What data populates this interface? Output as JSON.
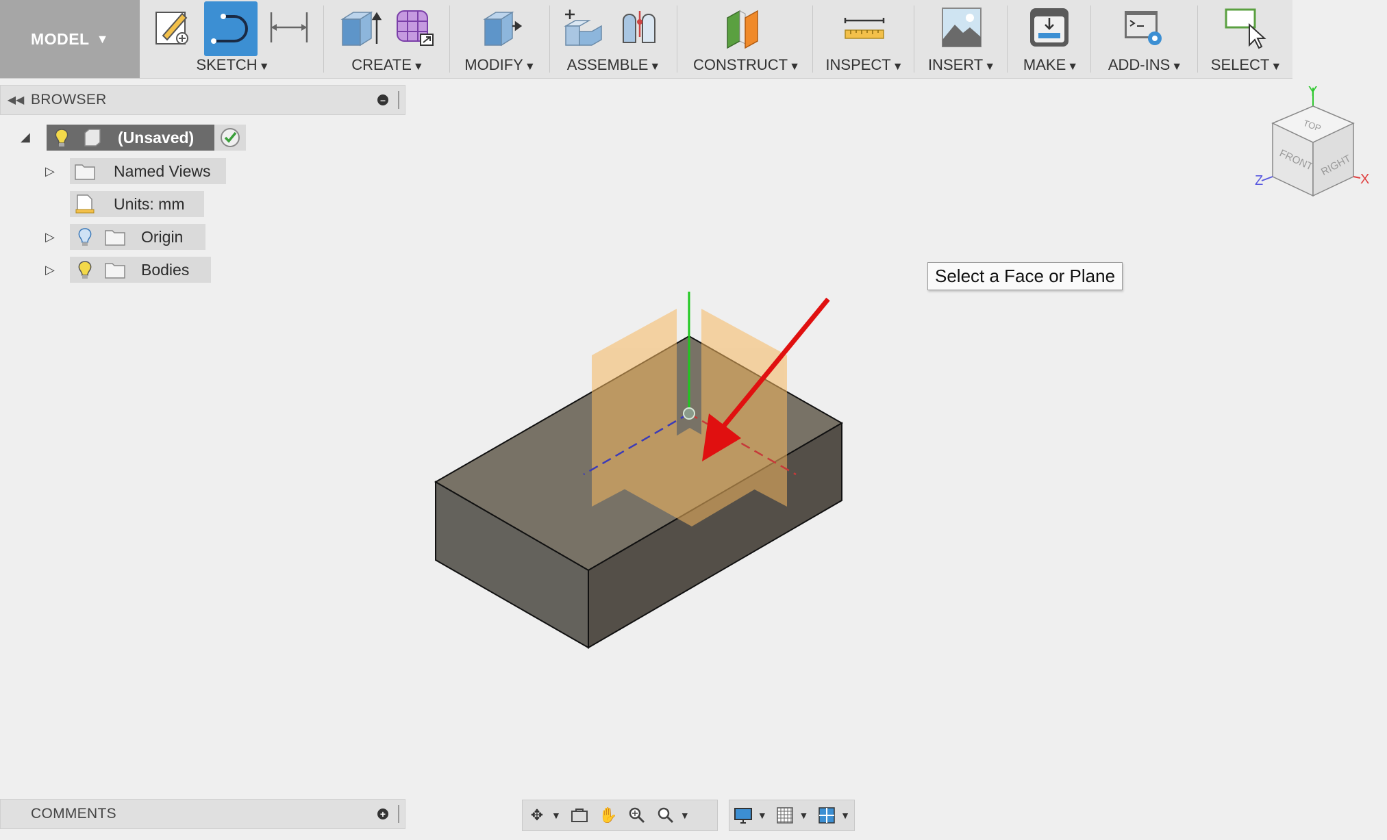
{
  "toolbar": {
    "workspace_label": "MODEL",
    "groups": {
      "sketch": "SKETCH",
      "create": "CREATE",
      "modify": "MODIFY",
      "assemble": "ASSEMBLE",
      "construct": "CONSTRUCT",
      "inspect": "INSPECT",
      "insert": "INSERT",
      "make": "MAKE",
      "addins": "ADD-INS",
      "select": "SELECT"
    }
  },
  "browser": {
    "title": "BROWSER",
    "root": "(Unsaved)",
    "items": [
      {
        "label": "Named Views"
      },
      {
        "label": "Units: mm"
      },
      {
        "label": "Origin"
      },
      {
        "label": "Bodies"
      }
    ]
  },
  "viewcube": {
    "faces": {
      "top": "TOP",
      "front": "FRONT",
      "right": "RIGHT"
    },
    "axes": {
      "x": "X",
      "y": "Y",
      "z": "Z"
    }
  },
  "tooltip": "Select a Face or Plane",
  "comments": {
    "title": "COMMENTS"
  },
  "colors": {
    "accent": "#3c8fd3",
    "arrow": "#e01010",
    "plane": "#f5b860",
    "body": "#5c5a52"
  }
}
